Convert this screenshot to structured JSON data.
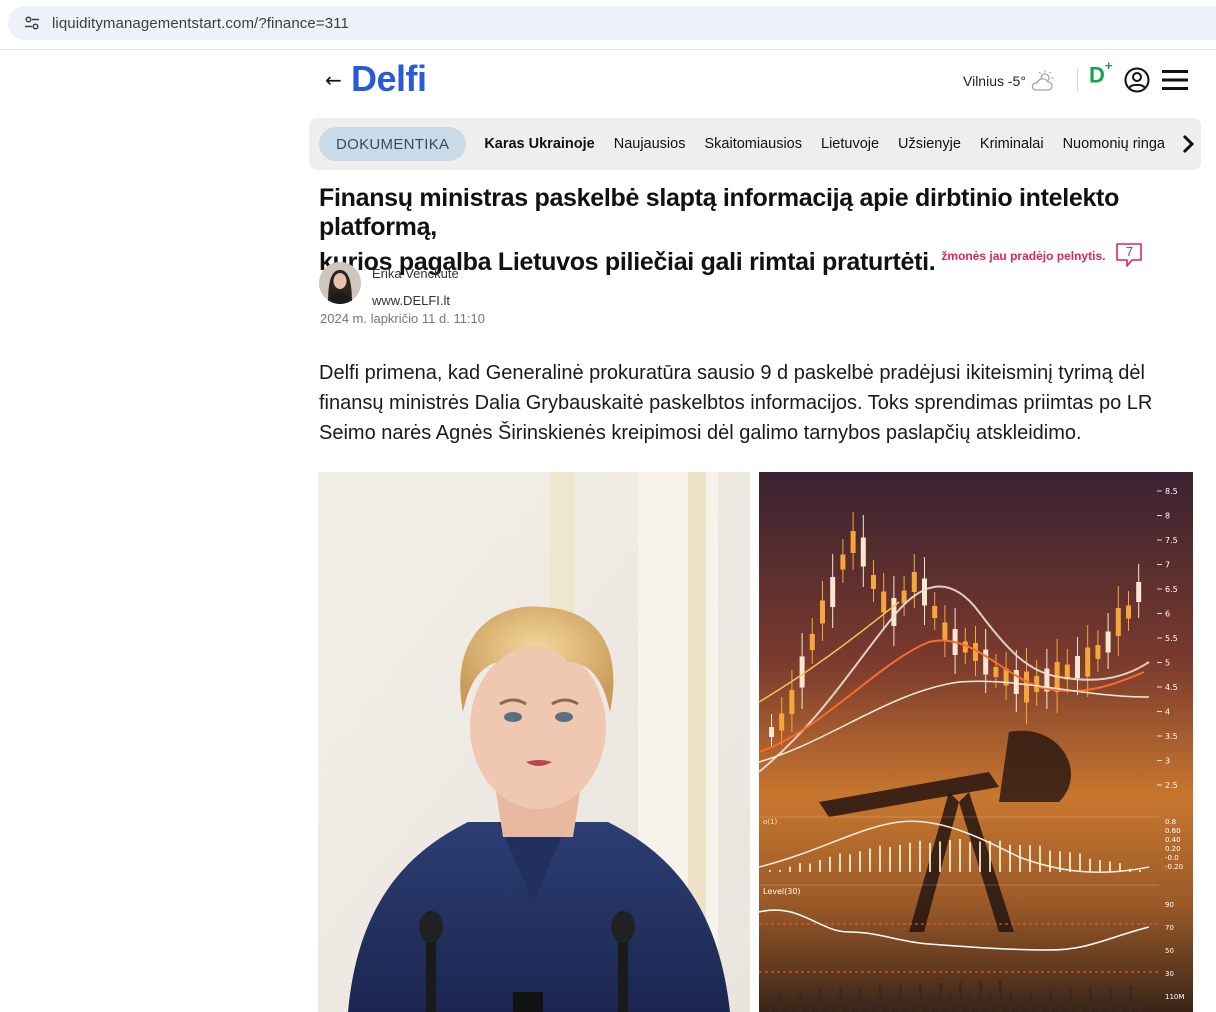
{
  "browser": {
    "url": "liquiditymanagementstart.com/?finance=311"
  },
  "header": {
    "logo": "Delfi",
    "weather": "Vilnius -5°",
    "plus_brand": "D",
    "plus_sign": "+"
  },
  "nav": {
    "pill": "DOKUMENTIKA",
    "items": [
      {
        "label": "Karas Ukrainoje",
        "bold": true
      },
      {
        "label": "Naujausios"
      },
      {
        "label": "Skaitomiausios"
      },
      {
        "label": "Lietuvoje"
      },
      {
        "label": "Užsienyje"
      },
      {
        "label": "Kriminalai"
      },
      {
        "label": "Nuomonių ringa"
      }
    ]
  },
  "article": {
    "headline_line1": "Finansų ministras paskelbė slaptą informaciją apie dirbtinio intelekto platformą,",
    "headline_line2": "kurios pagalba Lietuvos piliečiai gali rimtai praturtėti.",
    "tag": "žmonės jau pradėjo pelnytis.",
    "comment_count": "7",
    "author": "Erika Venckutė",
    "source": "www.DELFI.lt",
    "date": "2024 m. lapkričio 11 d. 11:10",
    "lead": "Delfi primena, kad Generalinė prokuratūra sausio 9 d paskelbė pradėjusi ikiteisminį tyrimą dėl finansų ministrės Dalia Grybauskaitė paskelbtos informacijos. Toks sprendimas priimtas po LR Seimo narės Agnės Širinskienės kreipimosi dėl galimo tarnybos paslapčių atskleidimo."
  },
  "images": {
    "chart_axis_labels": [
      "8.5",
      "8",
      "7.5",
      "7",
      "6.5",
      "6",
      "5.5",
      "5",
      "4.5",
      "4",
      "3.5",
      "3",
      "2.5"
    ],
    "indicator_labels": [
      "0.8",
      "0.60",
      "0.40",
      "0.20",
      "-0.0",
      "-0.20"
    ],
    "lower_labels": [
      "90",
      "70",
      "50",
      "30",
      "110M"
    ],
    "lower_caption": "Level(30)"
  }
}
